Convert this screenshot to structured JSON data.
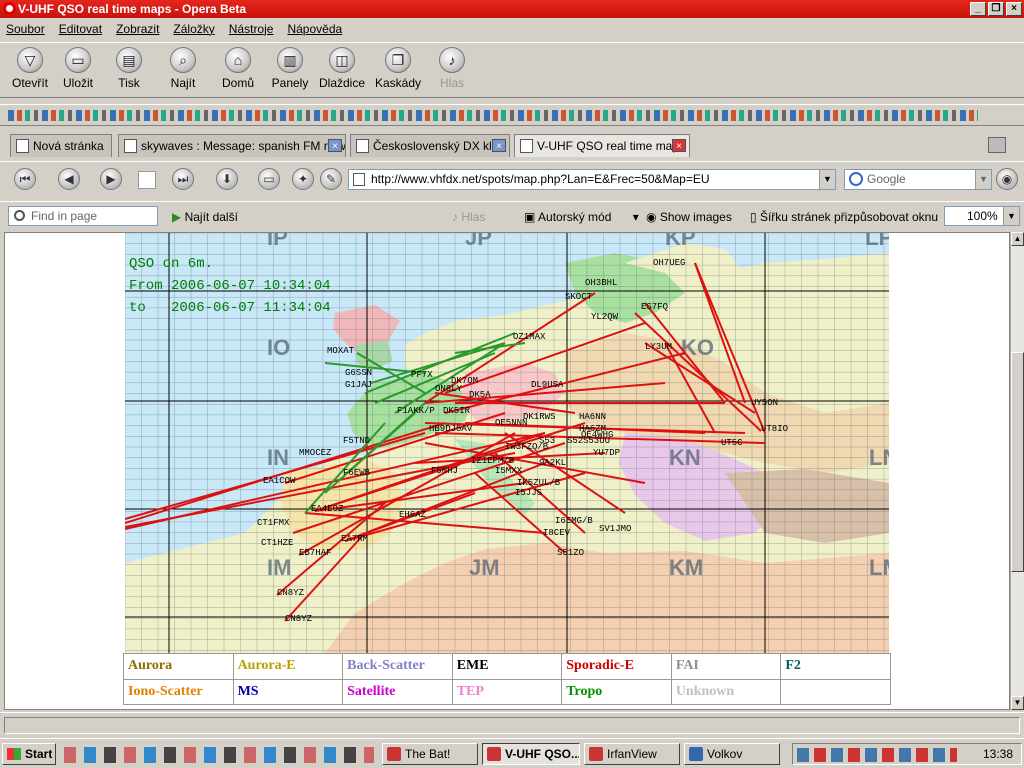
{
  "window": {
    "title": "V-UHF QSO real time maps - Opera Beta"
  },
  "menu": [
    "Soubor",
    "Editovat",
    "Zobrazit",
    "Záložky",
    "Nástroje",
    "Nápověda"
  ],
  "toolbar": {
    "open": "Otevřít",
    "save": "Uložit",
    "print": "Tisk",
    "find": "Najít",
    "home": "Domů",
    "panels": "Panely",
    "tile": "Dlaždice",
    "cascade": "Kaskády",
    "voice": "Hlas"
  },
  "tabs": [
    {
      "label": "Nová stránka"
    },
    {
      "label": "skywaves : Message: spanish FM now"
    },
    {
      "label": "Československý DX klub"
    },
    {
      "label": "V-UHF QSO real time maps"
    }
  ],
  "address": {
    "url": "http://www.vhfdx.net/spots/map.php?Lan=E&Frec=50&Map=EU",
    "search_placeholder": "Google"
  },
  "findbar": {
    "placeholder": "Find in page",
    "next": "Najít další",
    "voice": "Hlas",
    "author_mode": "Autorský mód",
    "show_images": "Show images",
    "fit_width": "Šířku stránek přizpůsobovat oknu",
    "zoom": "100%"
  },
  "map": {
    "header": [
      "QSO on 6m.",
      "From 2006-06-07 10:34:04",
      "to   2006-06-07 11:34:04"
    ],
    "grid_labels": [
      "IP",
      "JP",
      "KP",
      "LP",
      "IO",
      "KO",
      "IN",
      "KN",
      "LN",
      "IM",
      "JM",
      "KM",
      "LM"
    ],
    "stations": [
      "OH7UEG",
      "OH3BHL",
      "SKOCT",
      "ES7FQ",
      "YL2QW",
      "OZ1MAX",
      "LY3UM",
      "MOXAT",
      "G6SSN",
      "G1JAJ",
      "PF7X",
      "DK7OM",
      "ON8LY",
      "DL9USA",
      "DK5A",
      "UY5ON",
      "F1AKK/P",
      "DK5IR",
      "UT8IO",
      "DK1RWS",
      "HA6NN",
      "HA6ZM",
      "HB9DJ5AV",
      "OE5NNN",
      "F5TND",
      "OE4WHG",
      "UT5C",
      "S53",
      "S52",
      "S53UU",
      "MMOCEZ",
      "IW3FZQ/B",
      "YU7DP",
      "IZ1EPM/B",
      "9A2KL",
      "F6EWB",
      "F5NHJ",
      "I5MXX",
      "EA1COW",
      "IK5ZUL/B",
      "EA4EOZ",
      "I5JJS",
      "CT1FMX",
      "EH6AZ",
      "I6EMG/B",
      "CT1HZE",
      "I8CEV",
      "SV1JMO",
      "EB7HAF",
      "EA7RM",
      "S51ZO",
      "CN8YZ",
      "CN8YZ"
    ]
  },
  "legend": [
    {
      "label": "Aurora",
      "color": "#8a7000"
    },
    {
      "label": "Aurora-E",
      "color": "#b8a000"
    },
    {
      "label": "Back-Scatter",
      "color": "#8080c8"
    },
    {
      "label": "EME",
      "color": "#000000"
    },
    {
      "label": "Sporadic-E",
      "color": "#cc0000"
    },
    {
      "label": "FAI",
      "color": "#909090"
    },
    {
      "label": "F2",
      "color": "#006060"
    },
    {
      "label": "Iono-Scatter",
      "color": "#e08000"
    },
    {
      "label": "MS",
      "color": "#0000aa"
    },
    {
      "label": "Satellite",
      "color": "#cc00cc"
    },
    {
      "label": "TEP",
      "color": "#f080d0"
    },
    {
      "label": "Tropo",
      "color": "#009000"
    },
    {
      "label": "Unknown",
      "color": "#c0c0c0"
    },
    {
      "label": "",
      "color": "#000000"
    }
  ],
  "taskbar": {
    "start": "Start",
    "tasks": [
      "The Bat!",
      "V-UHF QSO...",
      "IrfanView",
      "Volkov"
    ],
    "clock": "13:38"
  }
}
